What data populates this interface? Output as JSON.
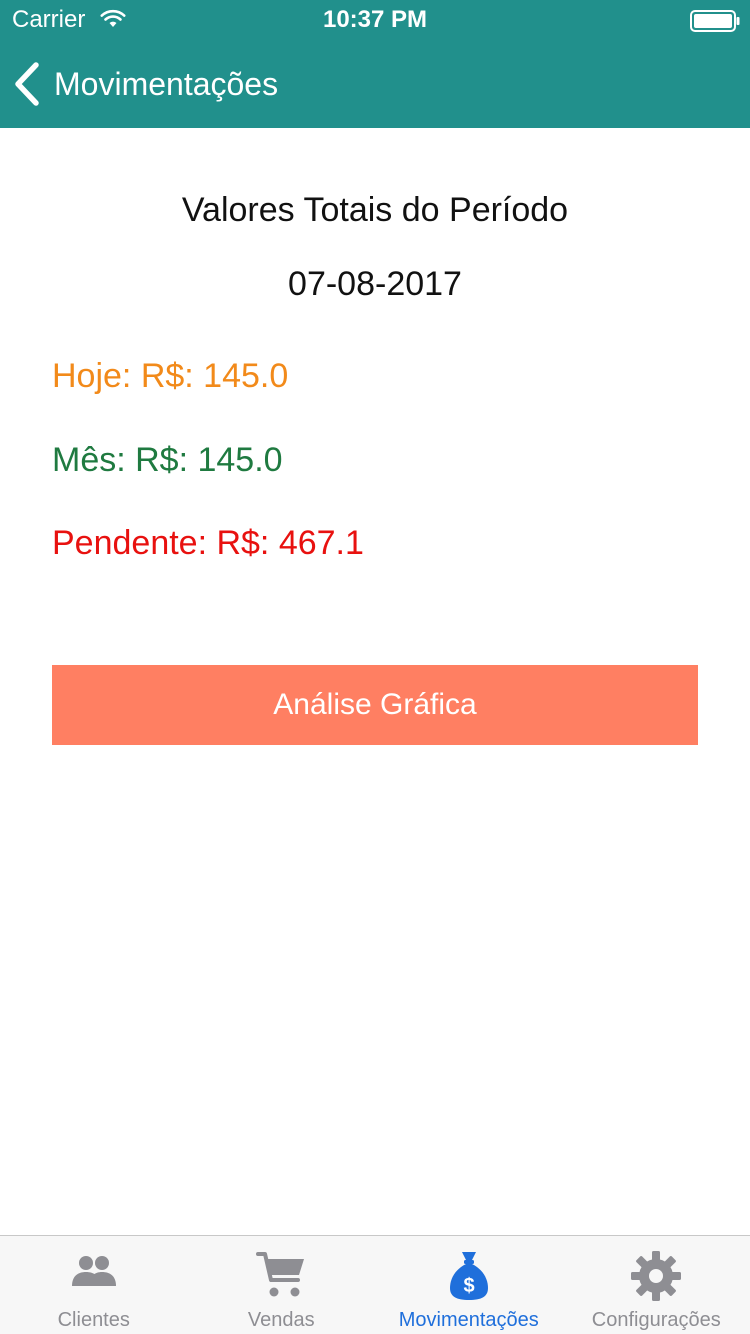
{
  "status_bar": {
    "carrier": "Carrier",
    "time": "10:37 PM",
    "wifi_icon": "wifi-icon",
    "battery_icon": "battery-icon"
  },
  "nav": {
    "back_icon": "chevron-left-icon",
    "title": "Movimentações",
    "background_color": "#21908c"
  },
  "summary": {
    "title": "Valores Totais do Período",
    "date": "07-08-2017",
    "today": {
      "text": "Hoje: R$: 145.0",
      "color": "#f28a1a"
    },
    "month": {
      "text": "Mês: R$: 145.0",
      "color": "#1f7a40"
    },
    "pending": {
      "text": "Pendente: R$: 467.1",
      "color": "#e8110f"
    }
  },
  "chart_button": {
    "label": "Análise Gráfica",
    "color": "#ff7f62"
  },
  "tab_bar": {
    "active_color": "#1f6fdb",
    "inactive_color": "#8e8e93",
    "tabs": [
      {
        "label": "Clientes",
        "icon": "users-icon",
        "active": false
      },
      {
        "label": "Vendas",
        "icon": "cart-icon",
        "active": false
      },
      {
        "label": "Movimentações",
        "icon": "money-bag-icon",
        "active": true
      },
      {
        "label": "Configurações",
        "icon": "gear-icon",
        "active": false
      }
    ]
  }
}
